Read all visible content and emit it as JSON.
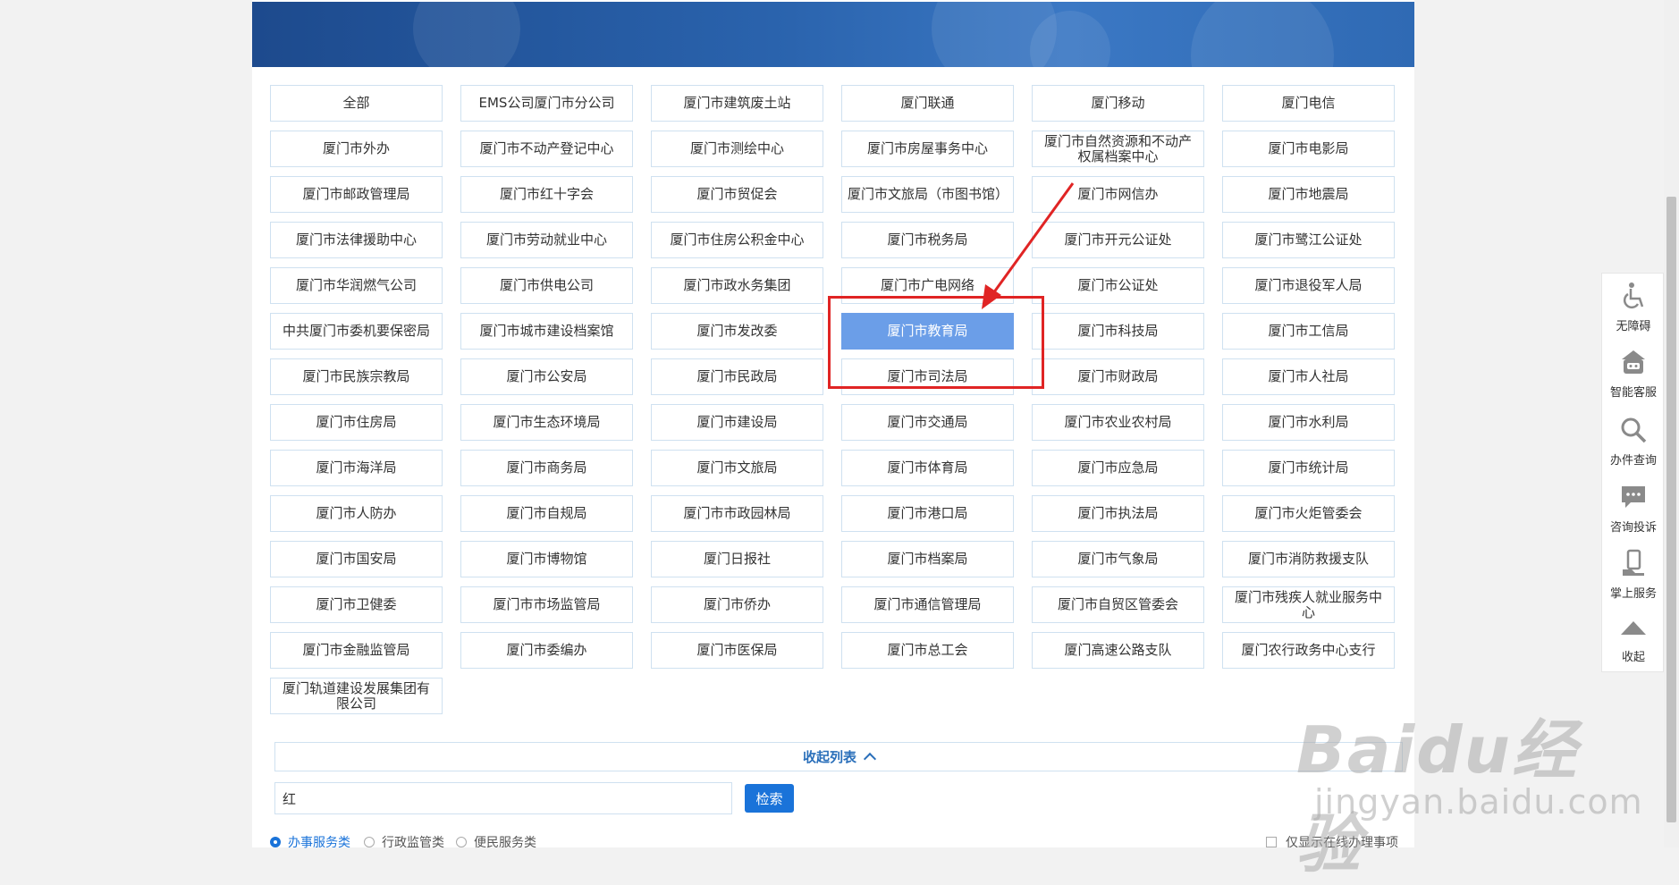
{
  "departments": [
    "全部",
    "EMS公司厦门市分公司",
    "厦门市建筑废土站",
    "厦门联通",
    "厦门移动",
    "厦门电信",
    "厦门市外办",
    "厦门市不动产登记中心",
    "厦门市测绘中心",
    "厦门市房屋事务中心",
    "厦门市自然资源和不动产权属档案中心",
    "厦门市电影局",
    "厦门市邮政管理局",
    "厦门市红十字会",
    "厦门市贸促会",
    "厦门市文旅局（市图书馆）",
    "厦门市网信办",
    "厦门市地震局",
    "厦门市法律援助中心",
    "厦门市劳动就业中心",
    "厦门市住房公积金中心",
    "厦门市税务局",
    "厦门市开元公证处",
    "厦门市鹭江公证处",
    "厦门市华润燃气公司",
    "厦门市供电公司",
    "厦门市政水务集团",
    "厦门市广电网络",
    "厦门市公证处",
    "厦门市退役军人局",
    "中共厦门市委机要保密局",
    "厦门市城市建设档案馆",
    "厦门市发改委",
    "厦门市教育局",
    "厦门市科技局",
    "厦门市工信局",
    "厦门市民族宗教局",
    "厦门市公安局",
    "厦门市民政局",
    "厦门市司法局",
    "厦门市财政局",
    "厦门市人社局",
    "厦门市住房局",
    "厦门市生态环境局",
    "厦门市建设局",
    "厦门市交通局",
    "厦门市农业农村局",
    "厦门市水利局",
    "厦门市海洋局",
    "厦门市商务局",
    "厦门市文旅局",
    "厦门市体育局",
    "厦门市应急局",
    "厦门市统计局",
    "厦门市人防办",
    "厦门市自规局",
    "厦门市市政园林局",
    "厦门市港口局",
    "厦门市执法局",
    "厦门市火炬管委会",
    "厦门市国安局",
    "厦门市博物馆",
    "厦门日报社",
    "厦门市档案局",
    "厦门市气象局",
    "厦门市消防救援支队",
    "厦门市卫健委",
    "厦门市市场监管局",
    "厦门市侨办",
    "厦门市通信管理局",
    "厦门市自贸区管委会",
    "厦门市残疾人就业服务中心",
    "厦门市金融监管局",
    "厦门市委编办",
    "厦门市医保局",
    "厦门市总工会",
    "厦门高速公路支队",
    "厦门农行政务中心支行",
    "厦门轨道建设发展集团有限公司"
  ],
  "selected_department": "厦门市教育局",
  "collapse": {
    "label": "收起列表"
  },
  "search": {
    "value": "红",
    "button": "检索"
  },
  "filters": {
    "options": [
      "办事服务类",
      "行政监管类",
      "便民服务类"
    ],
    "checked": "办事服务类",
    "online_only": "仅显示在线办理事项"
  },
  "sidebar": {
    "items": [
      {
        "label": "无障碍",
        "icon": "wheelchair-icon"
      },
      {
        "label": "智能客服",
        "icon": "robot-icon"
      },
      {
        "label": "办件查询",
        "icon": "search-icon"
      },
      {
        "label": "咨询投诉",
        "icon": "chat-icon"
      },
      {
        "label": "掌上服务",
        "icon": "mobile-icon"
      },
      {
        "label": "收起",
        "icon": "collapse-up-icon"
      }
    ]
  },
  "watermark": {
    "brand": "Baidu经验",
    "url": "jingyan.baidu.com"
  },
  "colors": {
    "accent": "#1a73d9",
    "selected": "#6b9ee8",
    "annotation": "#e02424",
    "border": "#cfe1f0"
  }
}
